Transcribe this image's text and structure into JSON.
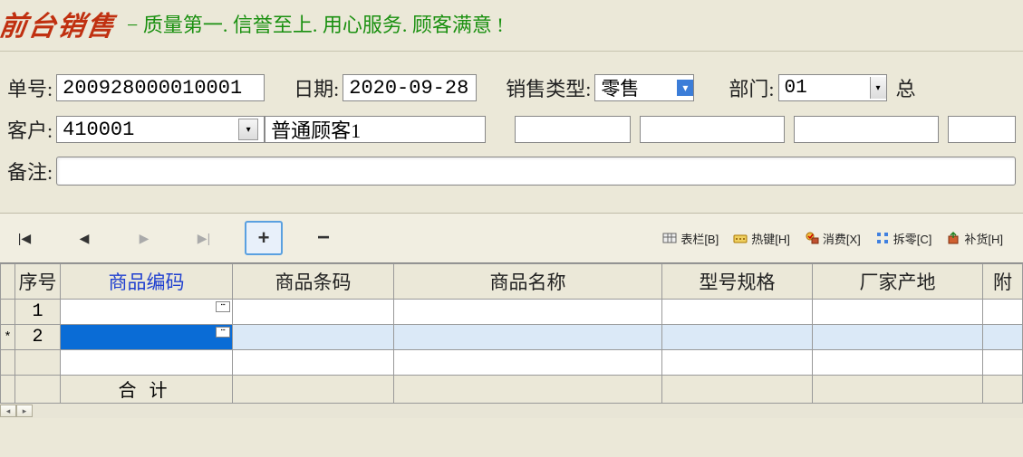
{
  "header": {
    "title": "前台销售",
    "slogan": "− 质量第一. 信誉至上. 用心服务. 顾客满意 !"
  },
  "form": {
    "order_no_label": "单号:",
    "order_no": "200928000010001",
    "date_label": "日期:",
    "date": "2020-09-28",
    "sale_type_label": "销售类型:",
    "sale_type": "零售",
    "dept_label": "部门:",
    "dept": "01",
    "total_label": "总",
    "customer_label": "客户:",
    "customer_code": "410001",
    "customer_name": "普通顾客1",
    "remark_label": "备注:"
  },
  "toolbar": {
    "first": "|◀",
    "prev": "◀",
    "next": "▶",
    "last": "▶|",
    "add": "+",
    "remove": "−",
    "actions": [
      {
        "icon": "grid-icon",
        "label": "表栏[B]"
      },
      {
        "icon": "keyboard-icon",
        "label": "热键[H]"
      },
      {
        "icon": "cart-icon",
        "label": "消费[X]"
      },
      {
        "icon": "split-icon",
        "label": "拆零[C]"
      },
      {
        "icon": "restock-icon",
        "label": "补货[H]"
      }
    ]
  },
  "grid": {
    "columns": [
      "序号",
      "商品编码",
      "商品条码",
      "商品名称",
      "型号规格",
      "厂家产地",
      "附"
    ],
    "link_columns": [
      1
    ],
    "rows": [
      {
        "seq": "1",
        "cells": [
          "",
          "",
          "",
          "",
          "",
          ""
        ],
        "ellipsis_col": 0
      },
      {
        "seq": "2",
        "cells": [
          "",
          "",
          "",
          "",
          "",
          ""
        ],
        "selected_col": 0,
        "ellipsis_col": 0,
        "marker": "*"
      }
    ],
    "blank_rows": 1,
    "total_label": "合计"
  }
}
